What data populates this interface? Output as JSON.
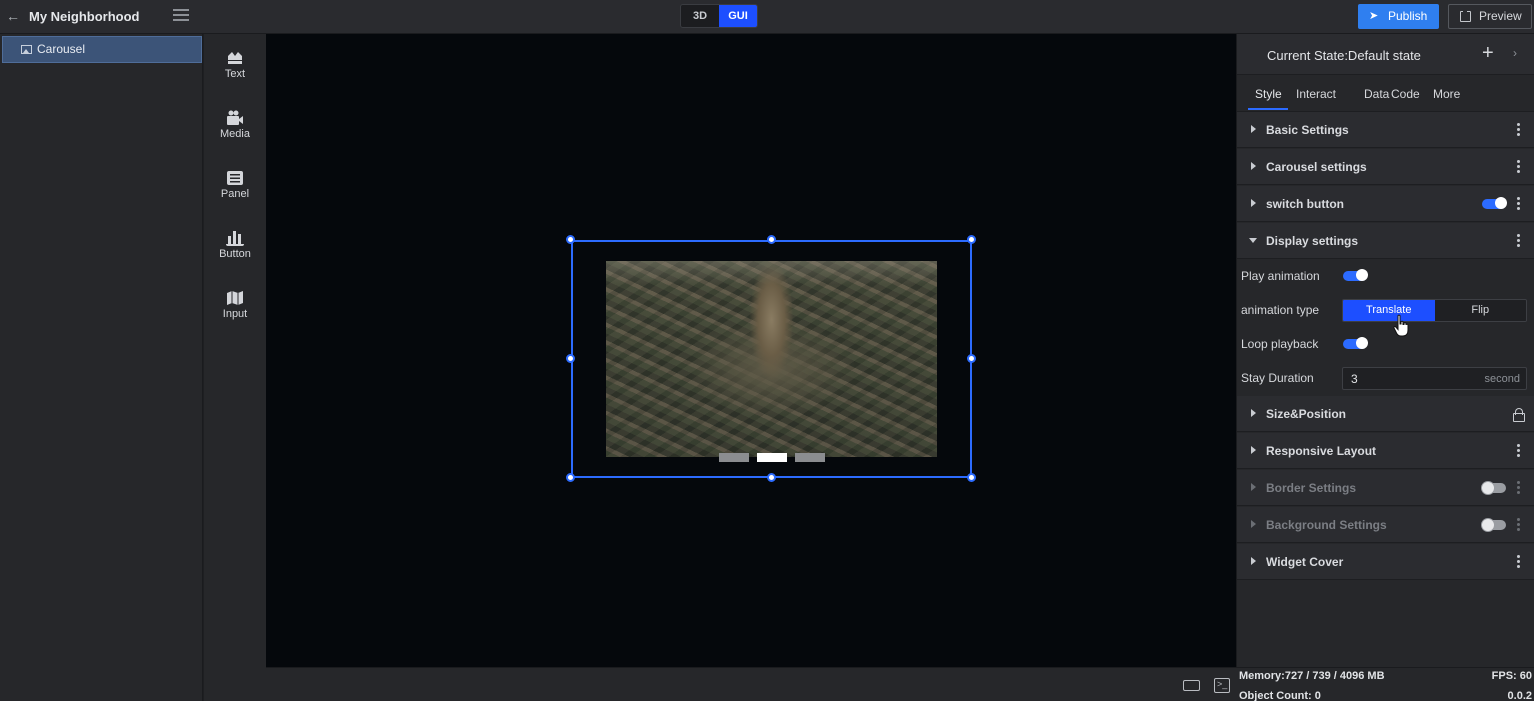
{
  "header": {
    "project_title": "My Neighborhood",
    "mode_3d": "3D",
    "mode_gui": "GUI",
    "publish_label": "Publish",
    "preview_label": "Preview",
    "accent_color": "#1d4fff"
  },
  "layers": {
    "items": [
      {
        "label": "Carousel",
        "icon": "image-icon",
        "selected": true
      }
    ]
  },
  "palette": {
    "items": [
      {
        "label": "Text",
        "icon": "text-icon"
      },
      {
        "label": "Media",
        "icon": "media-icon"
      },
      {
        "label": "Panel",
        "icon": "panel-icon"
      },
      {
        "label": "Button",
        "icon": "button-icon"
      },
      {
        "label": "Input",
        "icon": "input-icon"
      }
    ]
  },
  "canvas": {
    "carousel_page_count": 3,
    "carousel_active_index": 1
  },
  "panel": {
    "current_state": "Current State:Default state",
    "tabs": [
      "Style",
      "Interact",
      "Data",
      "Code",
      "More"
    ],
    "active_tab": "Style",
    "sections": {
      "basic": "Basic Settings",
      "carousel": "Carousel settings",
      "switch": "switch button",
      "display": "Display settings",
      "size": "Size&Position",
      "responsive": "Responsive Layout",
      "border": "Border Settings",
      "background": "Background Settings",
      "cover": "Widget Cover"
    },
    "display": {
      "play_animation_label": "Play animation",
      "play_animation_on": true,
      "animation_type_label": "animation type",
      "animation_options": [
        "Translate",
        "Flip"
      ],
      "animation_selected": "Translate",
      "loop_label": "Loop playback",
      "loop_on": true,
      "stay_label": "Stay Duration",
      "stay_value": "3",
      "stay_unit": "second"
    }
  },
  "status": {
    "memory": "Memory:727 / 739 / 4096 MB",
    "object_count": "Object Count: 0",
    "fps": "FPS: 60",
    "version": "0.0.2"
  }
}
